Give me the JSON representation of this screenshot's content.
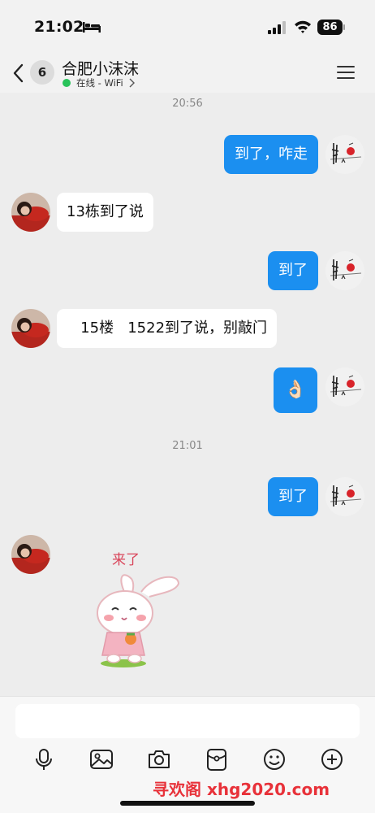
{
  "status_bar": {
    "time": "21:02",
    "battery": "86",
    "icons": [
      "bed-icon",
      "signal-icon",
      "wifi-icon",
      "battery-icon"
    ]
  },
  "nav": {
    "back_icon": "chevron-left-icon",
    "unread_count": "6",
    "title": "合肥小沫沫",
    "presence": "在线 - WiFi",
    "presence_color": "#29c35a",
    "menu_icon": "hamburger-menu-icon"
  },
  "messages": [
    {
      "type": "time",
      "text": "20:56"
    },
    {
      "type": "outgoing",
      "text": "到了，咋走"
    },
    {
      "type": "incoming",
      "text": "13栋到了说"
    },
    {
      "type": "outgoing",
      "text": "到了"
    },
    {
      "type": "incoming",
      "text": "   15楼   1522到了说，别敲门"
    },
    {
      "type": "outgoing",
      "text": "👌🏻"
    },
    {
      "type": "time",
      "text": "21:01"
    },
    {
      "type": "outgoing",
      "text": "到了"
    },
    {
      "type": "incoming-sticker",
      "caption": "来了"
    }
  ],
  "input": {
    "placeholder": "",
    "tools": [
      "microphone-icon",
      "image-icon",
      "camera-icon",
      "red-packet-icon",
      "emoji-icon",
      "plus-icon"
    ]
  },
  "watermark": "寻欢阁 xhg2020.com",
  "colors": {
    "outgoing_bubble": "#1b8ff0",
    "incoming_bubble": "#ffffff",
    "background": "#ededed",
    "watermark": "#e8323a"
  }
}
